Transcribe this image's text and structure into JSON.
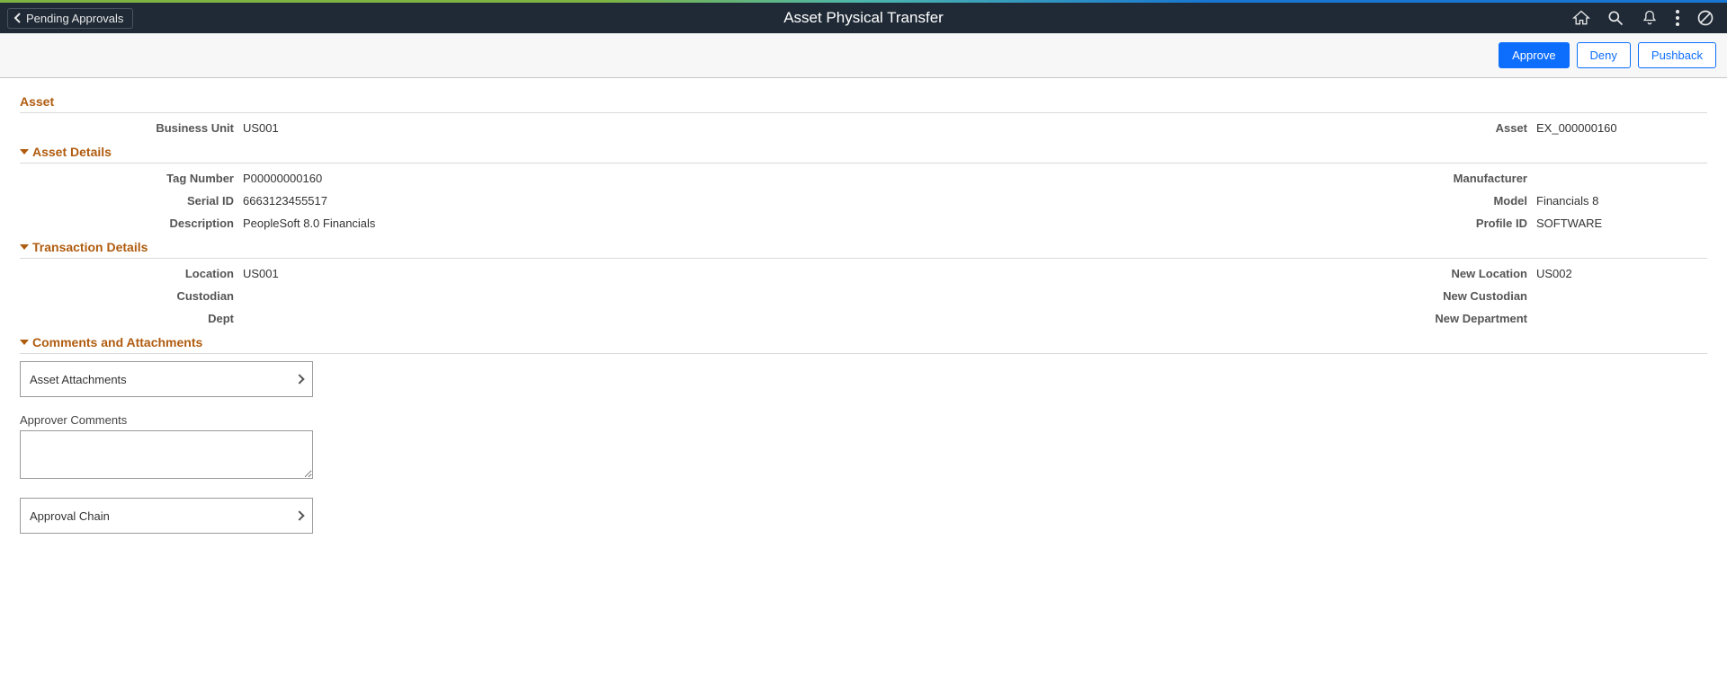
{
  "header": {
    "back_label": "Pending Approvals",
    "title": "Asset Physical Transfer"
  },
  "actions": {
    "approve": "Approve",
    "deny": "Deny",
    "pushback": "Pushback"
  },
  "sections": {
    "asset": "Asset",
    "asset_details": "Asset Details",
    "transaction_details": "Transaction Details",
    "comments_attachments": "Comments and Attachments"
  },
  "asset": {
    "business_unit_label": "Business Unit",
    "business_unit_value": "US001",
    "asset_label": "Asset",
    "asset_value": "EX_000000160"
  },
  "asset_details": {
    "tag_number_label": "Tag Number",
    "tag_number_value": "P00000000160",
    "manufacturer_label": "Manufacturer",
    "manufacturer_value": "",
    "serial_id_label": "Serial ID",
    "serial_id_value": "6663123455517",
    "model_label": "Model",
    "model_value": "Financials 8",
    "description_label": "Description",
    "description_value": "PeopleSoft 8.0 Financials",
    "profile_id_label": "Profile ID",
    "profile_id_value": "SOFTWARE"
  },
  "transaction": {
    "location_label": "Location",
    "location_value": "US001",
    "new_location_label": "New Location",
    "new_location_value": "US002",
    "custodian_label": "Custodian",
    "custodian_value": "",
    "new_custodian_label": "New Custodian",
    "new_custodian_value": "",
    "dept_label": "Dept",
    "dept_value": "",
    "new_department_label": "New Department",
    "new_department_value": ""
  },
  "attachments": {
    "asset_attachments": "Asset Attachments",
    "approver_comments_label": "Approver Comments",
    "approver_comments_value": "",
    "approval_chain": "Approval Chain"
  }
}
